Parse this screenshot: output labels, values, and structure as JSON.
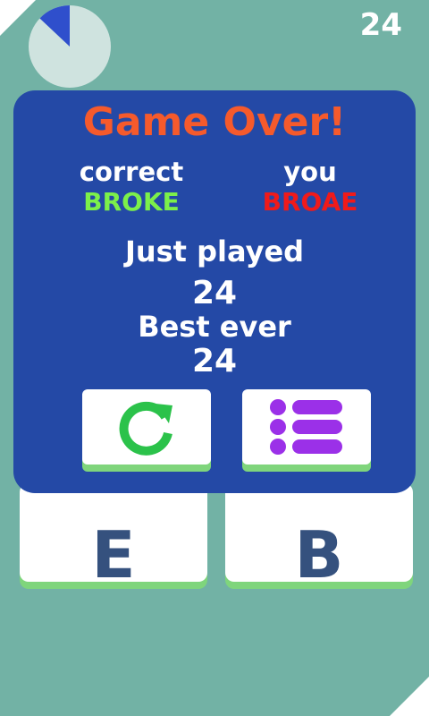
{
  "score": "24",
  "timer": {
    "progress": 0.13,
    "track_color": "#cfe3df",
    "fill_color": "#2f4fcc"
  },
  "tiles": [
    {
      "letter": "E"
    },
    {
      "letter": "B"
    }
  ],
  "dialog": {
    "title": "Game Over!",
    "correct_label": "correct",
    "correct_word": "BROKE",
    "you_label": "you",
    "you_word": "BROAE",
    "just_played_label": "Just played",
    "just_played_value": "24",
    "best_ever_label": "Best ever",
    "best_ever_value": "24"
  },
  "buttons": {
    "retry_icon": "refresh-icon",
    "retry_color": "#2bc24a",
    "menu_icon": "list-icon",
    "menu_color": "#9b30e8"
  }
}
